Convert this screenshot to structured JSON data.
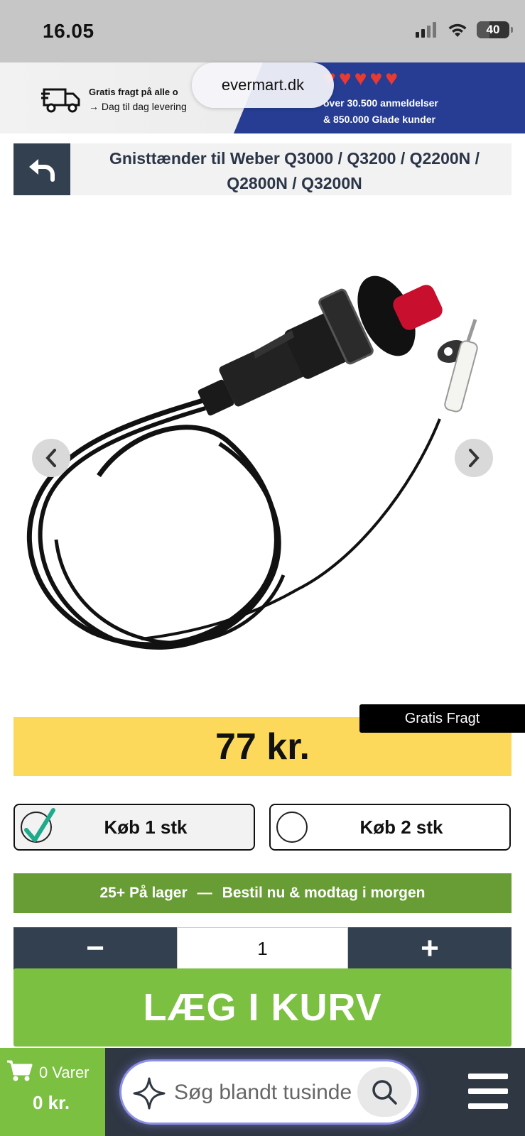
{
  "status_bar": {
    "time": "16.05",
    "battery": "40",
    "battery_level_percent": 40
  },
  "promo": {
    "shipping_line1": "Gratis fragt på alle o",
    "shipping_line2": "→ Dag til dag levering",
    "reviews_line1": "over 30.500 anmeldelser",
    "reviews_line2": "& 850.000 Glade kunder",
    "heart_count": 5
  },
  "browser": {
    "url": "evermart.dk"
  },
  "product": {
    "title": "Gnisttænder til Weber Q3000 / Q3200 / Q2200N / Q2800N / Q3200N",
    "price": "77 kr.",
    "badge": "Gratis Fragt"
  },
  "options": [
    {
      "label": "Køb 1 stk",
      "selected": true
    },
    {
      "label": "Køb 2 stk",
      "selected": false
    }
  ],
  "stock": {
    "count": "25+ På lager",
    "separator": "—",
    "message": "Bestil nu & modtag i morgen"
  },
  "stepper": {
    "minus": "−",
    "value": "1",
    "plus": "+"
  },
  "add_to_cart": {
    "label": "LÆG I KURV"
  },
  "bottom_bar": {
    "cart_count": "0 Varer",
    "cart_total": "0 kr.",
    "search_placeholder": "Søg blandt tusinde"
  },
  "colors": {
    "accent_navy": "#334050",
    "price_yellow": "#fcd95a",
    "stock_green": "#689c34",
    "cart_green": "#7cc041",
    "promo_blue": "#263d93",
    "heart_red": "#e63a33"
  }
}
